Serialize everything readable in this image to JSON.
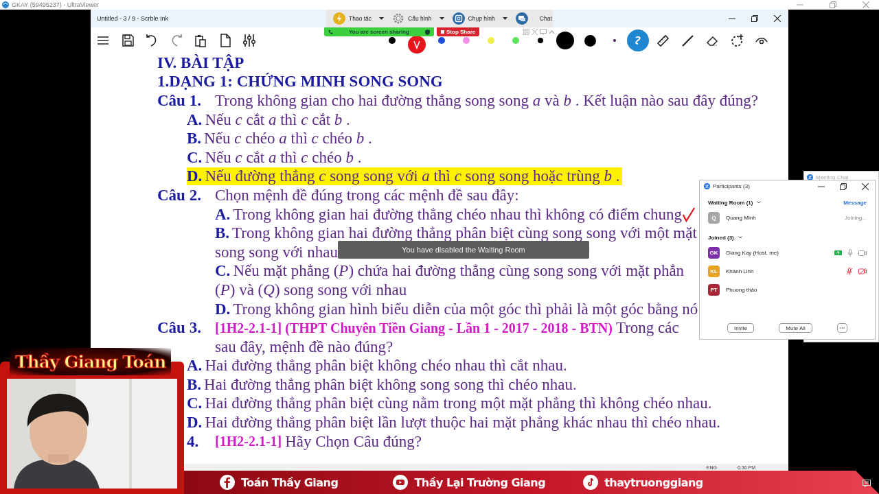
{
  "viewer": {
    "title": "GKAY (59495237) - UltraViewer"
  },
  "app": {
    "title": "Untitled - 3 / 9 - Scrble Ink"
  },
  "viewer_toolbar": [
    {
      "kind": "action",
      "label": "Thao tác",
      "dropdown": true
    },
    {
      "kind": "settings",
      "label": "Cấu hình",
      "dropdown": true
    },
    {
      "kind": "capture",
      "label": "Chụp hình",
      "dropdown": true
    },
    {
      "kind": "chat",
      "label": "Chat",
      "dropdown": false
    }
  ],
  "share_banner": {
    "status": "You are screen sharing",
    "stop": "Stop Share"
  },
  "palette": [
    {
      "color": "#000000",
      "selected": false
    },
    {
      "color": "#e8141b",
      "selected": true
    },
    {
      "color": "#1f4fd6",
      "selected": false
    },
    {
      "color": "#f08ee6",
      "selected": false
    },
    {
      "color": "#f0f04a",
      "selected": false
    },
    {
      "color": "#5be35b",
      "selected": false
    }
  ],
  "tools": [
    {
      "kind": "pen",
      "selected": true
    },
    {
      "kind": "ruler",
      "selected": false
    },
    {
      "kind": "line",
      "selected": false
    },
    {
      "kind": "eraser",
      "selected": false
    },
    {
      "kind": "lasso",
      "selected": false
    },
    {
      "kind": "view",
      "selected": false
    }
  ],
  "document": {
    "part": "IV. BÀI TẬP",
    "section": "1.DẠNG 1: CHỨNG MINH SONG SONG",
    "questions": [
      {
        "number": "Câu 1.",
        "kind": "flat",
        "lines": [
          "Trong không gian cho hai đường thẳng song song *a* và *b* . Kết luận nào sau đây đúng?"
        ],
        "options": [
          {
            "letter": "A.",
            "lines": [
              "Nếu *c* cắt *a* thì *c* cắt *b* ."
            ],
            "highlighted": false,
            "ticked": false
          },
          {
            "letter": "B.",
            "lines": [
              "Nếu *c* chéo *a* thì *c* chéo *b* ."
            ],
            "highlighted": false,
            "ticked": false
          },
          {
            "letter": "C.",
            "lines": [
              "Nếu *c* cắt *a* thì *c* chéo *b* ."
            ],
            "highlighted": false,
            "ticked": false
          },
          {
            "letter": "D.",
            "lines": [
              "Nếu đường thẳng *c* song song với *a* thì *c* song song hoặc trùng *b* ."
            ],
            "highlighted": true,
            "ticked": false
          }
        ]
      },
      {
        "number": "Câu 2.",
        "kind": "nested",
        "lines": [
          "Chọn mệnh đề đúng trong các mệnh đề sau đây:"
        ],
        "options": [
          {
            "letter": "A.",
            "lines": [
              "Trong không gian hai đường thẳng chéo nhau thì không có điểm chung"
            ],
            "highlighted": false,
            "ticked": true
          },
          {
            "letter": "B.",
            "lines": [
              "Trong không gian hai đường thẳng phân biệt cùng song song với một mặt",
              "song song với nhau"
            ],
            "highlighted": false,
            "ticked": false
          },
          {
            "letter": "C.",
            "lines": [
              "Nếu mặt phẳng (*P*) chứa hai đường thẳng cùng song song với mặt phẳn",
              "(*P*) và (*Q*) song song với nhau"
            ],
            "highlighted": false,
            "ticked": false
          },
          {
            "letter": "D.",
            "lines": [
              "Trong không gian hình biểu diễn của một góc thì phải là một góc bằng nó"
            ],
            "highlighted": false,
            "ticked": false
          }
        ]
      },
      {
        "number": "Câu 3.",
        "kind": "flat",
        "source": "[1H2-2.1-1] (THPT Chuyên Tiền Giang - Lần 1 - 2017 - 2018 - BTN)",
        "lines": [
          "Trong các",
          "sau đây, mệnh đề nào đúng?"
        ],
        "options": [
          {
            "letter": "A.",
            "lines": [
              "Hai đường thẳng phân biệt không chéo nhau thì cắt nhau."
            ],
            "highlighted": false,
            "ticked": false
          },
          {
            "letter": "B.",
            "lines": [
              "Hai đường thẳng phân biệt không song song thì chéo nhau."
            ],
            "highlighted": false,
            "ticked": false
          },
          {
            "letter": "C.",
            "lines": [
              "Hai đường thẳng phân biệt cùng nằm trong một mặt phẳng thì không chéo nhau."
            ],
            "highlighted": false,
            "ticked": false
          },
          {
            "letter": "D.",
            "lines": [
              "Hai đường thẳng phân biệt lần lượt thuộc hai mặt phẳng khác nhau thì chéo nhau."
            ],
            "highlighted": false,
            "ticked": false
          }
        ]
      },
      {
        "number": "4.",
        "kind": "list",
        "source": "[1H2-2.1-1]",
        "lines": [
          "Hãy Chọn Câu đúng?"
        ]
      }
    ]
  },
  "meeting_chat": {
    "title": "Meeting Chat"
  },
  "participants": {
    "title": "Participants (3)",
    "waiting": {
      "label": "Waiting Room (1)",
      "action": "Message",
      "people": [
        {
          "initials": "Q",
          "name": "Quang Minh",
          "status": "Joining...",
          "color": "#a6a6a6"
        }
      ]
    },
    "joined": {
      "label": "Joined (3)",
      "people": [
        {
          "initials": "GK",
          "name": "Giang Kay (Host, me)",
          "color": "#7b2fa8",
          "sharing": true,
          "media": true,
          "muted": false,
          "video_off": false
        },
        {
          "initials": "KL",
          "name": "Khánh Linh",
          "color": "#e8a323",
          "sharing": false,
          "media": true,
          "muted": true,
          "video_off": true
        },
        {
          "initials": "PT",
          "name": "Phuong thảo",
          "color": "#a8283a",
          "sharing": false,
          "media": false
        }
      ]
    },
    "buttons": [
      "Invite",
      "Mute All"
    ]
  },
  "toast": "You have disabled the Waiting Room",
  "webcam": {
    "title": "Thầy Giang Toán"
  },
  "taskbar": {
    "language": "ENG",
    "time": "6:36 PM"
  },
  "social": [
    {
      "kind": "facebook",
      "label": "Toán Thầy Giang"
    },
    {
      "kind": "youtube",
      "label": "Thầy Lại Trường Giang"
    },
    {
      "kind": "tiktok",
      "label": "thaytruonggiang"
    }
  ]
}
